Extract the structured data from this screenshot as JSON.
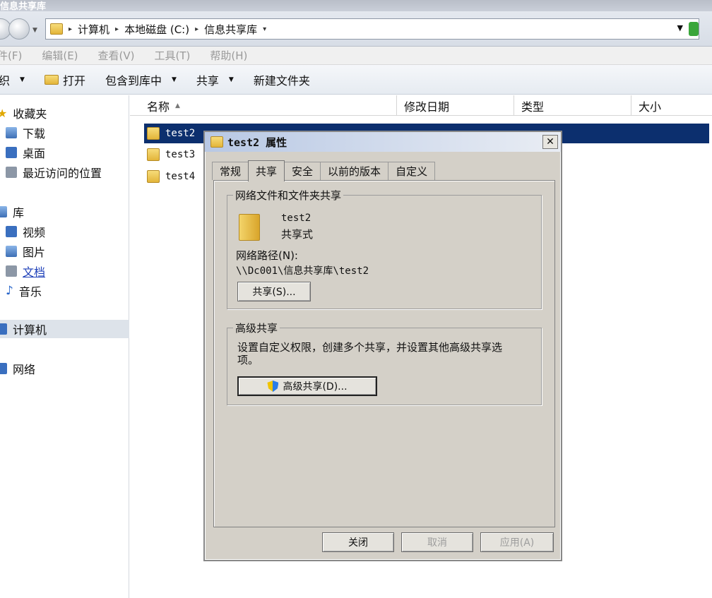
{
  "explorer": {
    "title": "信息共享库",
    "breadcrumbs": [
      "计算机",
      "本地磁盘 (C:)",
      "信息共享库"
    ],
    "menu": [
      "件(F)",
      "编辑(E)",
      "查看(V)",
      "工具(T)",
      "帮助(H)"
    ],
    "toolbar": {
      "organize": "织",
      "open": "打开",
      "include_library": "包含到库中",
      "share": "共享",
      "new_folder": "新建文件夹"
    },
    "sidebar": {
      "favorites": "收藏夹",
      "downloads": "下载",
      "desktop": "桌面",
      "recent": "最近访问的位置",
      "libraries": "库",
      "videos": "视频",
      "pictures": "图片",
      "documents": "文档",
      "music": "音乐",
      "computer": "计算机",
      "network": "网络"
    },
    "columns": {
      "name": "名称",
      "modified": "修改日期",
      "type": "类型",
      "size": "大小"
    },
    "files": [
      {
        "name": "test2",
        "selected": true
      },
      {
        "name": "test3",
        "selected": false
      },
      {
        "name": "test4",
        "selected": false
      }
    ]
  },
  "dialog": {
    "title": "test2 属性",
    "tabs": [
      "常规",
      "共享",
      "安全",
      "以前的版本",
      "自定义"
    ],
    "active_tab": "共享",
    "network_group_title": "网络文件和文件夹共享",
    "folder_name": "test2",
    "share_status": "共享式",
    "network_path_label": "网络路径(N):",
    "network_path": "\\\\Dc001\\信息共享库\\test2",
    "share_button": "共享(S)...",
    "advanced_group_title": "高级共享",
    "advanced_desc_line1": "设置自定义权限，创建多个共享，并设置其他高级共享选",
    "advanced_desc_line2": "项。",
    "advanced_button": "高级共享(D)...",
    "close_button": "关闭",
    "cancel_button": "取消",
    "apply_button": "应用(A)"
  }
}
